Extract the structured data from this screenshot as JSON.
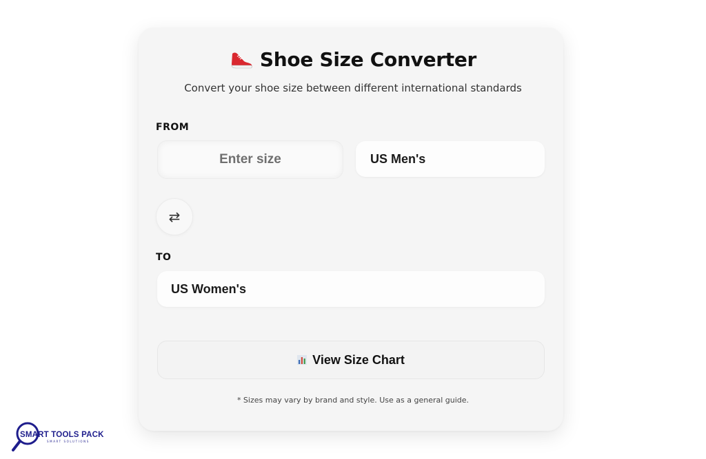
{
  "header": {
    "title": "Shoe Size Converter",
    "subtitle": "Convert your shoe size between different international standards",
    "icon": "shoe-icon"
  },
  "from": {
    "label": "FROM",
    "size_placeholder": "Enter size",
    "size_value": "",
    "unit": "US Men's"
  },
  "swap": {
    "icon": "⇄"
  },
  "to": {
    "label": "TO",
    "unit": "US Women's"
  },
  "chart_button": {
    "label": "View Size Chart",
    "icon": "bar-chart-icon"
  },
  "footnote": "* Sizes may vary by brand and style. Use as a general guide.",
  "brand": {
    "name": "SMART TOOLS PACK",
    "tagline": "SMART SOLUTIONS",
    "color": "#1e1d8c"
  },
  "colors": {
    "card_bg": "#f5f5f5",
    "shoe_red": "#d9282f"
  }
}
